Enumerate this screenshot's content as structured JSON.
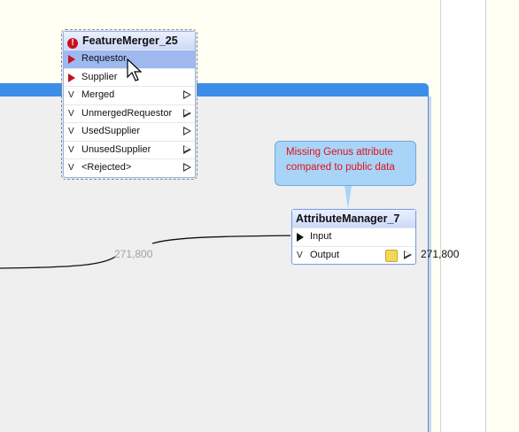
{
  "canvas": {
    "background": "#fffff4",
    "bookmark_color": "#3d8ee8"
  },
  "feature_merger": {
    "title": "FeatureMerger_25",
    "status_icon": "error-icon",
    "ports": [
      {
        "label": "Requestor",
        "kind": "input",
        "selected": true
      },
      {
        "label": "Supplier",
        "kind": "input",
        "selected": false
      },
      {
        "label": "Merged",
        "kind": "output"
      },
      {
        "label": "UnmergedRequestor",
        "kind": "output"
      },
      {
        "label": "UsedSupplier",
        "kind": "output"
      },
      {
        "label": "UnusedSupplier",
        "kind": "output"
      },
      {
        "label": "<Rejected>",
        "kind": "output"
      }
    ]
  },
  "annotation": {
    "text_line1": "Missing Genus attribute",
    "text_line2": "compared to public data",
    "color": "#e0101c"
  },
  "attribute_manager": {
    "title": "AttributeManager_7",
    "input_label": "Input",
    "output_label": "Output",
    "output_icon": "feature-cache-icon"
  },
  "connection": {
    "feature_count": "271,800"
  },
  "output_count": "271,800",
  "cursor": "arrow-cursor"
}
